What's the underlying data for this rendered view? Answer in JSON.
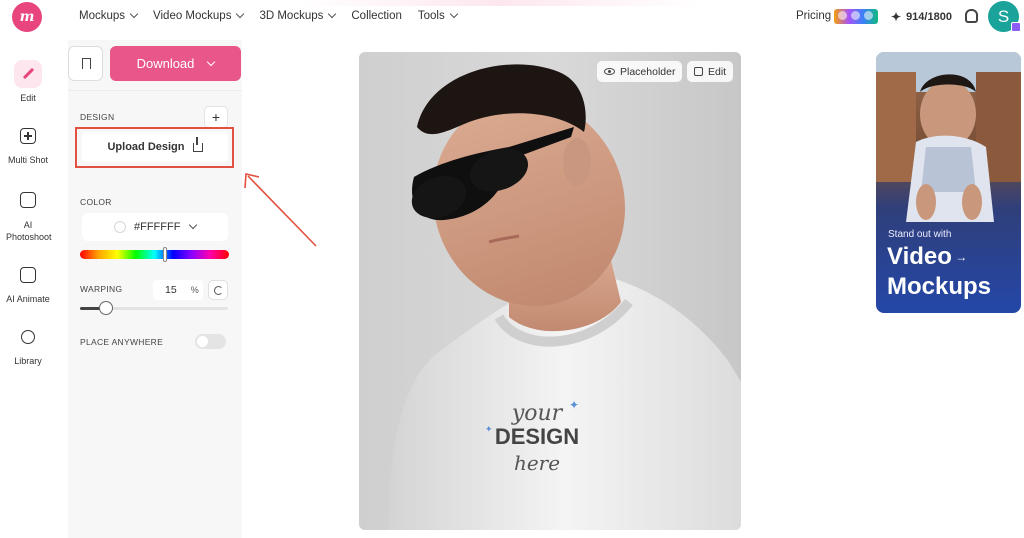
{
  "app": {
    "logo_text": "m"
  },
  "nav": {
    "items": [
      {
        "label": "Mockups"
      },
      {
        "label": "Video Mockups"
      },
      {
        "label": "3D Mockups"
      },
      {
        "label": "Collection"
      },
      {
        "label": "Tools"
      }
    ],
    "pricing_label": "Pricing",
    "credits": "914/1800",
    "avatar_initial": "S"
  },
  "sidebar": {
    "items": [
      {
        "label": "Edit",
        "icon": "pencil-icon"
      },
      {
        "label": "Multi Shot",
        "icon": "multi-shot-icon"
      },
      {
        "label": "AI Photoshoot",
        "icon": "ai-photoshoot-icon"
      },
      {
        "label": "AI Animate",
        "icon": "ai-animate-icon"
      },
      {
        "label": "Library",
        "icon": "library-icon"
      }
    ]
  },
  "toolbar": {
    "download_label": "Download"
  },
  "panel": {
    "design_label": "DESIGN",
    "upload_label": "Upload Design",
    "color_label": "COLOR",
    "color_value": "#FFFFFF",
    "warping_label": "WARPING",
    "warping_value": "15",
    "warping_unit": "%",
    "place_anywhere_label": "PLACE ANYWHERE",
    "place_anywhere_on": false
  },
  "canvas": {
    "placeholder_label": "Placeholder",
    "edit_label": "Edit",
    "design_text_1": "your",
    "design_text_2": "DESIGN",
    "design_text_3": "here"
  },
  "promo": {
    "subtitle": "Stand out with",
    "title_line1": "Video",
    "title_line2": "Mockups"
  },
  "colors": {
    "accent": "#e8568a",
    "highlight": "#e2503f"
  }
}
